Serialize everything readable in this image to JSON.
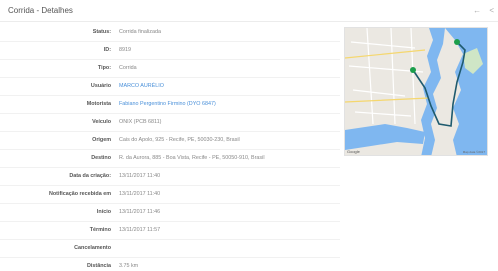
{
  "page": {
    "title": "Corrida - Detalhes",
    "icons": [
      "back-arrow-icon",
      "share-icon"
    ]
  },
  "details": [
    {
      "label": "Status:",
      "value": "Corrida finalizada",
      "link": false
    },
    {
      "label": "ID:",
      "value": "8919",
      "link": false
    },
    {
      "label": "Tipo:",
      "value": "Corrida",
      "link": false
    },
    {
      "label": "Usuário",
      "value": "MARCO AURÉLIO",
      "link": true
    },
    {
      "label": "Motorista",
      "value": "Fabiano Pergentino Firmino (DYO 6847)",
      "link": true
    },
    {
      "label": "Veículo",
      "value": "ONIX (PCB 6811)",
      "link": false
    },
    {
      "label": "Origem",
      "value": "Cais do Apolo, 925 - Recife, PE, 50030-230, Brasil",
      "link": false
    },
    {
      "label": "Destino",
      "value": "R. da Aurora, 885 - Boa Vista, Recife - PE, 50050-910, Brasil",
      "link": false
    },
    {
      "label": "Data da criação:",
      "value": "13/11/2017 11:40",
      "link": false
    },
    {
      "label": "Notificação recebida em",
      "value": "13/11/2017 11:40",
      "link": false
    },
    {
      "label": "Início",
      "value": "13/11/2017 11:46",
      "link": false
    },
    {
      "label": "Término",
      "value": "13/11/2017 11:57",
      "link": false
    },
    {
      "label": "Cancelamento",
      "value": "",
      "link": false
    },
    {
      "label": "Distância",
      "value": "3.75 km",
      "link": false
    }
  ],
  "map": {
    "provider": "Google",
    "credit": "Map data ©2017",
    "water_color": "#7fb7f0",
    "route_color": "#1e5a6e"
  }
}
